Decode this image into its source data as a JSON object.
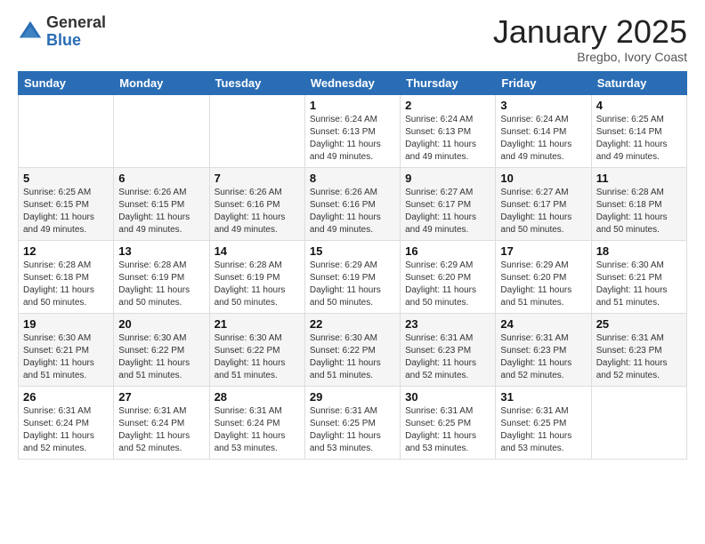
{
  "logo": {
    "general": "General",
    "blue": "Blue"
  },
  "title": "January 2025",
  "subtitle": "Bregbo, Ivory Coast",
  "weekdays": [
    "Sunday",
    "Monday",
    "Tuesday",
    "Wednesday",
    "Thursday",
    "Friday",
    "Saturday"
  ],
  "weeks": [
    [
      {
        "day": "",
        "info": ""
      },
      {
        "day": "",
        "info": ""
      },
      {
        "day": "",
        "info": ""
      },
      {
        "day": "1",
        "info": "Sunrise: 6:24 AM\nSunset: 6:13 PM\nDaylight: 11 hours and 49 minutes."
      },
      {
        "day": "2",
        "info": "Sunrise: 6:24 AM\nSunset: 6:13 PM\nDaylight: 11 hours and 49 minutes."
      },
      {
        "day": "3",
        "info": "Sunrise: 6:24 AM\nSunset: 6:14 PM\nDaylight: 11 hours and 49 minutes."
      },
      {
        "day": "4",
        "info": "Sunrise: 6:25 AM\nSunset: 6:14 PM\nDaylight: 11 hours and 49 minutes."
      }
    ],
    [
      {
        "day": "5",
        "info": "Sunrise: 6:25 AM\nSunset: 6:15 PM\nDaylight: 11 hours and 49 minutes."
      },
      {
        "day": "6",
        "info": "Sunrise: 6:26 AM\nSunset: 6:15 PM\nDaylight: 11 hours and 49 minutes."
      },
      {
        "day": "7",
        "info": "Sunrise: 6:26 AM\nSunset: 6:16 PM\nDaylight: 11 hours and 49 minutes."
      },
      {
        "day": "8",
        "info": "Sunrise: 6:26 AM\nSunset: 6:16 PM\nDaylight: 11 hours and 49 minutes."
      },
      {
        "day": "9",
        "info": "Sunrise: 6:27 AM\nSunset: 6:17 PM\nDaylight: 11 hours and 49 minutes."
      },
      {
        "day": "10",
        "info": "Sunrise: 6:27 AM\nSunset: 6:17 PM\nDaylight: 11 hours and 50 minutes."
      },
      {
        "day": "11",
        "info": "Sunrise: 6:28 AM\nSunset: 6:18 PM\nDaylight: 11 hours and 50 minutes."
      }
    ],
    [
      {
        "day": "12",
        "info": "Sunrise: 6:28 AM\nSunset: 6:18 PM\nDaylight: 11 hours and 50 minutes."
      },
      {
        "day": "13",
        "info": "Sunrise: 6:28 AM\nSunset: 6:19 PM\nDaylight: 11 hours and 50 minutes."
      },
      {
        "day": "14",
        "info": "Sunrise: 6:28 AM\nSunset: 6:19 PM\nDaylight: 11 hours and 50 minutes."
      },
      {
        "day": "15",
        "info": "Sunrise: 6:29 AM\nSunset: 6:19 PM\nDaylight: 11 hours and 50 minutes."
      },
      {
        "day": "16",
        "info": "Sunrise: 6:29 AM\nSunset: 6:20 PM\nDaylight: 11 hours and 50 minutes."
      },
      {
        "day": "17",
        "info": "Sunrise: 6:29 AM\nSunset: 6:20 PM\nDaylight: 11 hours and 51 minutes."
      },
      {
        "day": "18",
        "info": "Sunrise: 6:30 AM\nSunset: 6:21 PM\nDaylight: 11 hours and 51 minutes."
      }
    ],
    [
      {
        "day": "19",
        "info": "Sunrise: 6:30 AM\nSunset: 6:21 PM\nDaylight: 11 hours and 51 minutes."
      },
      {
        "day": "20",
        "info": "Sunrise: 6:30 AM\nSunset: 6:22 PM\nDaylight: 11 hours and 51 minutes."
      },
      {
        "day": "21",
        "info": "Sunrise: 6:30 AM\nSunset: 6:22 PM\nDaylight: 11 hours and 51 minutes."
      },
      {
        "day": "22",
        "info": "Sunrise: 6:30 AM\nSunset: 6:22 PM\nDaylight: 11 hours and 51 minutes."
      },
      {
        "day": "23",
        "info": "Sunrise: 6:31 AM\nSunset: 6:23 PM\nDaylight: 11 hours and 52 minutes."
      },
      {
        "day": "24",
        "info": "Sunrise: 6:31 AM\nSunset: 6:23 PM\nDaylight: 11 hours and 52 minutes."
      },
      {
        "day": "25",
        "info": "Sunrise: 6:31 AM\nSunset: 6:23 PM\nDaylight: 11 hours and 52 minutes."
      }
    ],
    [
      {
        "day": "26",
        "info": "Sunrise: 6:31 AM\nSunset: 6:24 PM\nDaylight: 11 hours and 52 minutes."
      },
      {
        "day": "27",
        "info": "Sunrise: 6:31 AM\nSunset: 6:24 PM\nDaylight: 11 hours and 52 minutes."
      },
      {
        "day": "28",
        "info": "Sunrise: 6:31 AM\nSunset: 6:24 PM\nDaylight: 11 hours and 53 minutes."
      },
      {
        "day": "29",
        "info": "Sunrise: 6:31 AM\nSunset: 6:25 PM\nDaylight: 11 hours and 53 minutes."
      },
      {
        "day": "30",
        "info": "Sunrise: 6:31 AM\nSunset: 6:25 PM\nDaylight: 11 hours and 53 minutes."
      },
      {
        "day": "31",
        "info": "Sunrise: 6:31 AM\nSunset: 6:25 PM\nDaylight: 11 hours and 53 minutes."
      },
      {
        "day": "",
        "info": ""
      }
    ]
  ]
}
